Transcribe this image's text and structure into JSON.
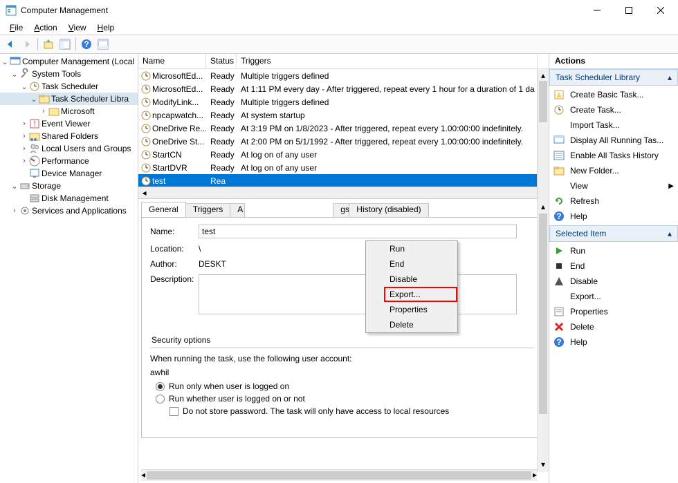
{
  "window": {
    "title": "Computer Management"
  },
  "menubar": [
    "File",
    "Action",
    "View",
    "Help"
  ],
  "tree": {
    "root": "Computer Management (Local",
    "system_tools": "System Tools",
    "task_scheduler": "Task Scheduler",
    "task_scheduler_library": "Task Scheduler Libra",
    "microsoft": "Microsoft",
    "event_viewer": "Event Viewer",
    "shared_folders": "Shared Folders",
    "local_users": "Local Users and Groups",
    "performance": "Performance",
    "device_manager": "Device Manager",
    "storage": "Storage",
    "disk_management": "Disk Management",
    "services_apps": "Services and Applications"
  },
  "task_columns": {
    "name": "Name",
    "status": "Status",
    "triggers": "Triggers"
  },
  "tasks": [
    {
      "name": "MicrosoftEd...",
      "status": "Ready",
      "triggers": "Multiple triggers defined"
    },
    {
      "name": "MicrosoftEd...",
      "status": "Ready",
      "triggers": "At 1:11 PM every day - After triggered, repeat every 1 hour for a duration of 1 da"
    },
    {
      "name": "ModifyLink...",
      "status": "Ready",
      "triggers": "Multiple triggers defined"
    },
    {
      "name": "npcapwatch...",
      "status": "Ready",
      "triggers": "At system startup"
    },
    {
      "name": "OneDrive Re...",
      "status": "Ready",
      "triggers": "At 3:19 PM on 1/8/2023 - After triggered, repeat every 1.00:00:00 indefinitely."
    },
    {
      "name": "OneDrive St...",
      "status": "Ready",
      "triggers": "At 2:00 PM on 5/1/1992 - After triggered, repeat every 1.00:00:00 indefinitely."
    },
    {
      "name": "StartCN",
      "status": "Ready",
      "triggers": "At log on of any user"
    },
    {
      "name": "StartDVR",
      "status": "Ready",
      "triggers": "At log on of any user"
    },
    {
      "name": "test",
      "status": "Rea",
      "triggers": ""
    }
  ],
  "context_menu": [
    "Run",
    "End",
    "Disable",
    "Export...",
    "Properties",
    "Delete"
  ],
  "context_highlight_index": 3,
  "tabs": [
    "General",
    "Triggers",
    "A",
    "gs",
    "History (disabled)"
  ],
  "details": {
    "name_label": "Name:",
    "name_value": "test",
    "location_label": "Location:",
    "location_value": "\\",
    "author_label": "Author:",
    "author_value": "DESKT",
    "description_label": "Description:",
    "security_title": "Security options",
    "security_text": "When running the task, use the following user account:",
    "security_user": "awhil",
    "radio1": "Run only when user is logged on",
    "radio2": "Run whether user is logged on or not",
    "chk1": "Do not store password.  The task will only have access to local resources"
  },
  "actions": {
    "header": "Actions",
    "section1": "Task Scheduler Library",
    "items1": [
      {
        "icon": "wizard",
        "label": "Create Basic Task..."
      },
      {
        "icon": "new",
        "label": "Create Task..."
      },
      {
        "icon": "",
        "label": "Import Task..."
      },
      {
        "icon": "display",
        "label": "Display All Running Tas..."
      },
      {
        "icon": "history",
        "label": "Enable All Tasks History"
      },
      {
        "icon": "folder",
        "label": "New Folder..."
      },
      {
        "icon": "",
        "label": "View",
        "submenu": true
      },
      {
        "icon": "refresh",
        "label": "Refresh"
      },
      {
        "icon": "help",
        "label": "Help"
      }
    ],
    "section2": "Selected Item",
    "items2": [
      {
        "icon": "run",
        "label": "Run"
      },
      {
        "icon": "end",
        "label": "End"
      },
      {
        "icon": "disable",
        "label": "Disable"
      },
      {
        "icon": "",
        "label": "Export..."
      },
      {
        "icon": "props",
        "label": "Properties"
      },
      {
        "icon": "delete",
        "label": "Delete"
      },
      {
        "icon": "help",
        "label": "Help"
      }
    ]
  }
}
